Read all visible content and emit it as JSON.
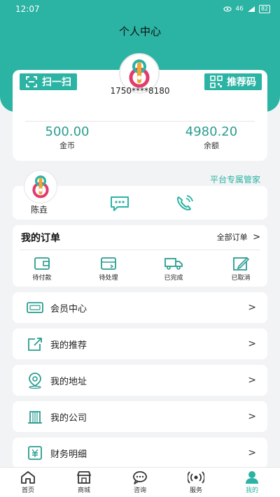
{
  "status": {
    "time": "12:07",
    "signal": "46",
    "battery": "82"
  },
  "header": {
    "title": "个人中心"
  },
  "profile": {
    "scan_label": "扫一扫",
    "recommend_label": "推荐码",
    "phone": "1750****8180",
    "coins_value": "500.00",
    "coins_label": "金币",
    "balance_value": "4980.20",
    "balance_label": "余额"
  },
  "manager": {
    "title": "平台专属管家",
    "name": "陈垚"
  },
  "orders": {
    "title": "我的订单",
    "all_label": "全部订单",
    "items": [
      {
        "label": "待付款"
      },
      {
        "label": "待处理"
      },
      {
        "label": "已完成"
      },
      {
        "label": "已取消"
      }
    ]
  },
  "menu": [
    {
      "label": "会员中心"
    },
    {
      "label": "我的推荐"
    },
    {
      "label": "我的地址"
    },
    {
      "label": "我的公司"
    },
    {
      "label": "财务明细"
    }
  ],
  "tabs": [
    {
      "label": "首页"
    },
    {
      "label": "商城"
    },
    {
      "label": "咨询"
    },
    {
      "label": "服务"
    },
    {
      "label": "我的"
    }
  ],
  "colors": {
    "accent": "#2bb3a3",
    "value": "#2a9d90"
  }
}
